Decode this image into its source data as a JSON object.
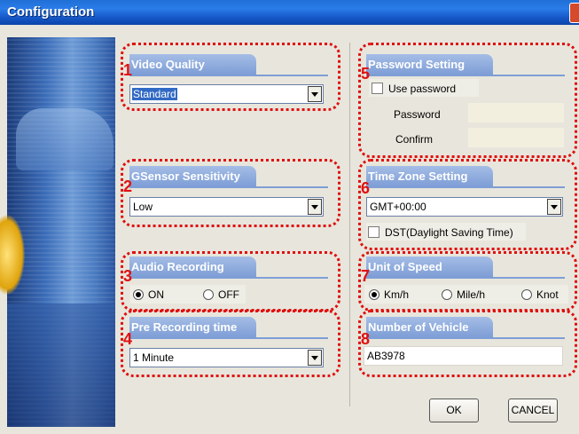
{
  "window": {
    "title": "Configuration"
  },
  "video_quality": {
    "number": "1",
    "title": "Video Quality",
    "value": "Standard"
  },
  "gsensor": {
    "number": "2",
    "title": "GSensor Sensitivity",
    "value": "Low"
  },
  "audio": {
    "number": "3",
    "title": "Audio Recording",
    "options": [
      "ON",
      "OFF"
    ],
    "selected": "ON"
  },
  "prerec": {
    "number": "4",
    "title": "Pre Recording time",
    "value": "1 Minute"
  },
  "password": {
    "number": "5",
    "title": "Password Setting",
    "use_label": "Use password",
    "checked": false,
    "password_label": "Password",
    "confirm_label": "Confirm"
  },
  "timezone": {
    "number": "6",
    "title": "Time Zone Setting",
    "value": "GMT+00:00",
    "dst_label": "DST(Daylight Saving Time)",
    "dst_checked": false
  },
  "speed": {
    "number": "7",
    "title": "Unit of Speed",
    "options": [
      "Km/h",
      "Mile/h",
      "Knot"
    ],
    "selected": "Km/h"
  },
  "vehicle": {
    "number": "8",
    "title": "Number of Vehicle",
    "value": "AB3978"
  },
  "buttons": {
    "ok": "OK",
    "cancel": "CANCEL"
  },
  "colors": {
    "titlebar": "#2a7ce8",
    "tab": "#8aa8dc",
    "annotation_red": "#e01010",
    "window_bg": "#e8e6dc"
  }
}
